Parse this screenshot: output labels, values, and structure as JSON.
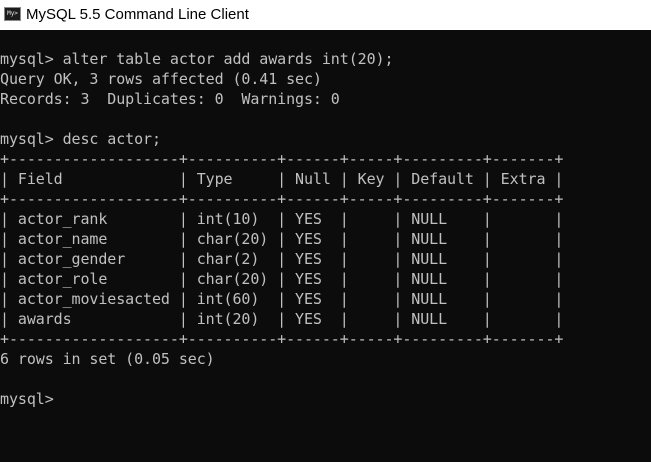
{
  "window": {
    "title": "MySQL 5.5 Command Line Client",
    "icon": "mysql-console-icon",
    "icon_text": "My>",
    "bg_color": "#0c0c0c",
    "text_color": "#c0c0c0"
  },
  "console": {
    "lines": [
      "mysql> alter table actor add awards int(20);",
      "Query OK, 3 rows affected (0.41 sec)",
      "Records: 3  Duplicates: 0  Warnings: 0",
      "",
      "mysql> desc actor;",
      "+-------------------+----------+------+-----+---------+-------+",
      "| Field             | Type     | Null | Key | Default | Extra |",
      "+-------------------+----------+------+-----+---------+-------+",
      "| actor_rank        | int(10)  | YES  |     | NULL    |       |",
      "| actor_name        | char(20) | YES  |     | NULL    |       |",
      "| actor_gender      | char(2)  | YES  |     | NULL    |       |",
      "| actor_role        | char(20) | YES  |     | NULL    |       |",
      "| actor_moviesacted | int(60)  | YES  |     | NULL    |       |",
      "| awards            | int(20)  | YES  |     | NULL    |       |",
      "+-------------------+----------+------+-----+---------+-------+",
      "6 rows in set (0.05 sec)",
      "",
      "mysql>"
    ]
  }
}
